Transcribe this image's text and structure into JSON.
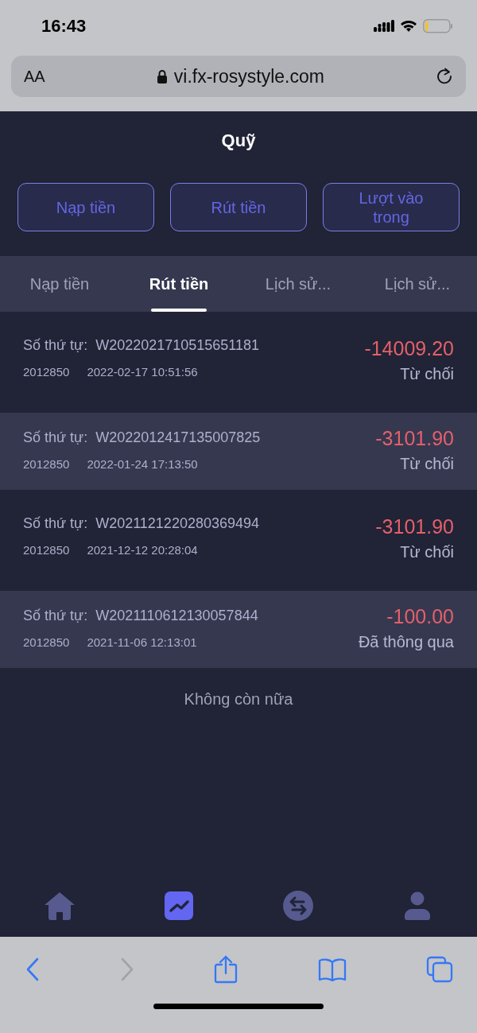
{
  "status_bar": {
    "time": "16:43"
  },
  "browser": {
    "text_size": "AA",
    "url": "vi.fx-rosystyle.com",
    "back_disabled": false,
    "forward_disabled": true
  },
  "header": {
    "title": "Quỹ"
  },
  "actions": [
    "Nạp tiền",
    "Rút tiền",
    "Lượt vào trong"
  ],
  "tabs": [
    {
      "label": "Nạp tiền",
      "selected": false
    },
    {
      "label": "Rút tiền",
      "selected": true
    },
    {
      "label": "Lịch sử...",
      "selected": false
    },
    {
      "label": "Lịch sử...",
      "selected": false
    }
  ],
  "records": [
    {
      "order_label": "Số thứ tự:",
      "order_no": "W2022021710515651181",
      "user_id": "2012850",
      "time": "2022-02-17 10:51:56",
      "amount": "-14009.20",
      "status": "Từ chối"
    },
    {
      "order_label": "Số thứ tự:",
      "order_no": "W2022012417135007825",
      "user_id": "2012850",
      "time": "2022-01-24 17:13:50",
      "amount": "-3101.90",
      "status": "Từ chối"
    },
    {
      "order_label": "Số thứ tự:",
      "order_no": "W2021121220280369494",
      "user_id": "2012850",
      "time": "2021-12-12 20:28:04",
      "amount": "-3101.90",
      "status": "Từ chối"
    },
    {
      "order_label": "Số thứ tự:",
      "order_no": "W2021110612130057844",
      "user_id": "2012850",
      "time": "2021-11-06 12:13:01",
      "amount": "-100.00",
      "status": "Đã thông qua"
    }
  ],
  "end_note": "Không còn nữa",
  "bottom_nav": [
    {
      "kind": "home",
      "selected": false
    },
    {
      "kind": "chart",
      "selected": true
    },
    {
      "kind": "exchange",
      "selected": false
    },
    {
      "kind": "user",
      "selected": false
    }
  ]
}
